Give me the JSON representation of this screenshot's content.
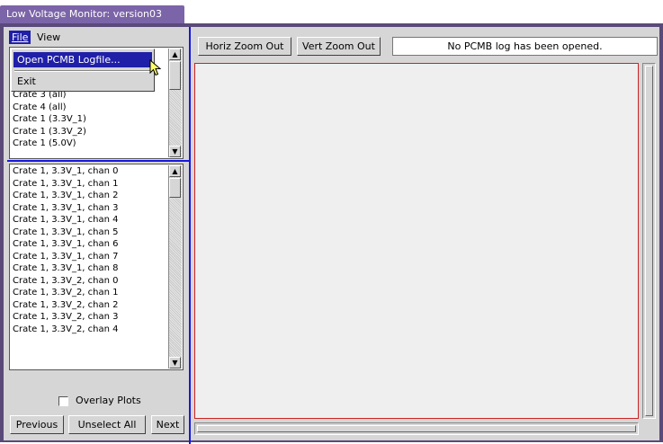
{
  "window": {
    "title": "Low Voltage Monitor: version03"
  },
  "menu": {
    "file": "File",
    "view": "View",
    "file_items": [
      "Open PCMB Logfile...",
      "Exit"
    ]
  },
  "crate_list": [
    "Crate 3 (all)",
    "Crate 4 (all)",
    "Crate 1 (3.3V_1)",
    "Crate 1 (3.3V_2)",
    "Crate 1 (5.0V)"
  ],
  "channel_list": [
    "Crate 1, 3.3V_1, chan 0",
    "Crate 1, 3.3V_1, chan 1",
    "Crate 1, 3.3V_1, chan 2",
    "Crate 1, 3.3V_1, chan 3",
    "Crate 1, 3.3V_1, chan 4",
    "Crate 1, 3.3V_1, chan 5",
    "Crate 1, 3.3V_1, chan 6",
    "Crate 1, 3.3V_1, chan 7",
    "Crate 1, 3.3V_1, chan 8",
    "Crate 1, 3.3V_2, chan 0",
    "Crate 1, 3.3V_2, chan 1",
    "Crate 1, 3.3V_2, chan 2",
    "Crate 1, 3.3V_2, chan 3",
    "Crate 1, 3.3V_2, chan 4"
  ],
  "overlay": {
    "label": "Overlay Plots",
    "checked": false
  },
  "buttons": {
    "previous": "Previous",
    "unselect_all": "Unselect All",
    "next": "Next",
    "horiz_zoom_out": "Horiz Zoom Out",
    "vert_zoom_out": "Vert Zoom Out"
  },
  "status": "No PCMB log has been opened.",
  "colors": {
    "title_bar": "#7b64a8",
    "selection": "#1f1fa8",
    "divider": "#1818e0",
    "plot_border": "#cc2222"
  }
}
